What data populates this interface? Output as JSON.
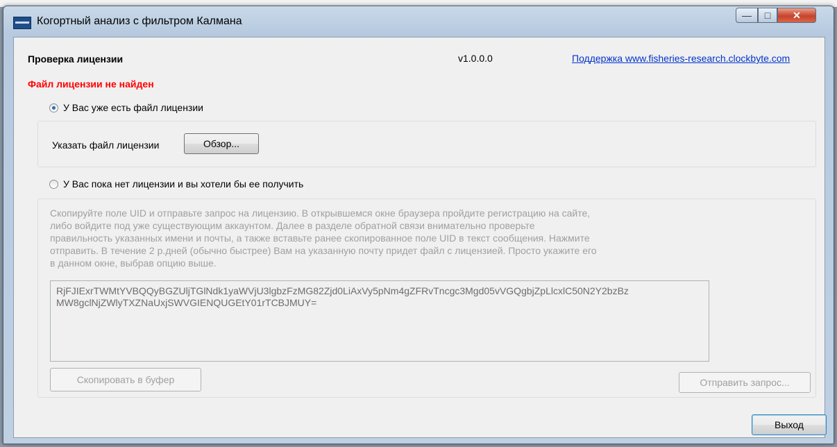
{
  "window": {
    "title": "Когортный анализ с фильтром Калмана"
  },
  "header": {
    "title": "Проверка лицензии",
    "version": "v1.0.0.0",
    "support_link": "Поддержка www.fisheries-research.clockbyte.com"
  },
  "status": {
    "error": "Файл лицензии не найден"
  },
  "option_has_license": {
    "label": "У Вас уже есть файл лицензии",
    "selected": true,
    "file_label": "Указать файл лицензии",
    "browse_button": "Обзор..."
  },
  "option_no_license": {
    "label": "У Вас пока нет лицензии и вы хотели бы ее получить",
    "selected": false,
    "instructions": "Скопируйте поле UID и отправьте запрос на лицензию. В открывшемся окне браузера пройдите регистрацию на сайте,\nлибо войдите под уже существующим аккаунтом. Далее в разделе обратной связи внимательно проверьте\nправильность указанных имени и почты, а также вставьте ранее скопированное поле UID в текст сообщения. Нажмите\nотправить. В течение 2 р.дней (обычно быстрее) Вам на указанную почту придет файл с лицензией. Просто укажите его\nв данном окне, выбрав опцию выше.",
    "uid": "RjFJIExrTWMtYVBQQyBGZUljTGlNdk1yaWVjU3lgbzFzMG82Zjd0LiAxVy5pNm4gZFRvTncgc3Mgd05vVGQgbjZpLlcxlC50N2Y2bzBz\nMW8gclNjZWlyTXZNaUxjSWVGIENQUGEtY01rTCBJMUY=",
    "copy_button": "Скопировать в буфер",
    "send_button": "Отправить запрос..."
  },
  "footer": {
    "exit_button": "Выход"
  }
}
